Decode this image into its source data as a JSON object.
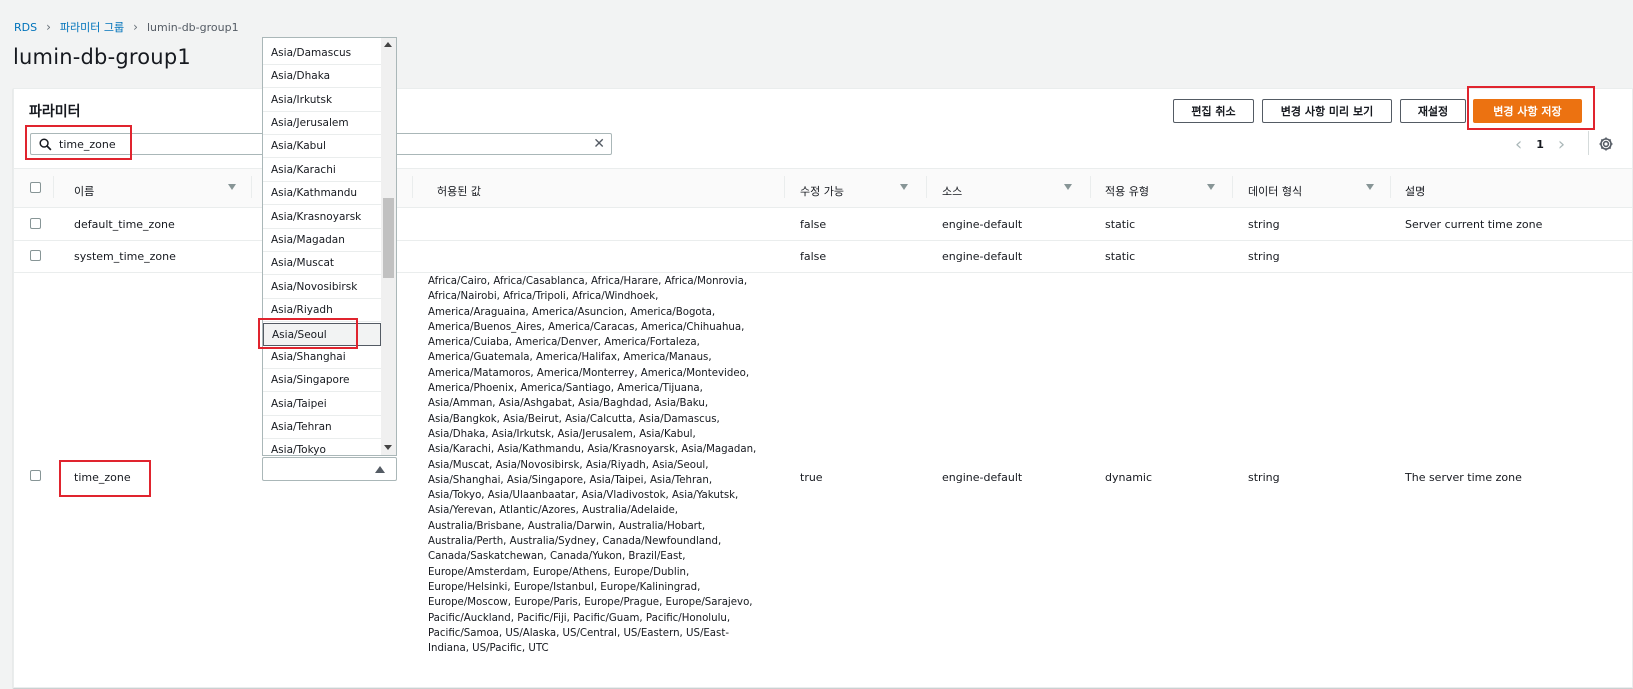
{
  "breadcrumb": {
    "root": "RDS",
    "parent": "파라미터 그룹",
    "current": "lumin-db-group1"
  },
  "page_title": "lumin-db-group1",
  "panel": {
    "title": "파라미터",
    "search_value": "time_zone",
    "buttons": {
      "cancel": "편집 취소",
      "preview": "변경 사항 미리 보기",
      "reset": "재설정",
      "save": "변경 사항 저장"
    },
    "pagination": {
      "page": "1"
    }
  },
  "table": {
    "headers": {
      "name": "이름",
      "allowed": "허용된 값",
      "modifiable": "수정 가능",
      "source": "소스",
      "apply_type": "적용 유형",
      "data_type": "데이터 형식",
      "description": "설명"
    },
    "rows": [
      {
        "name": "default_time_zone",
        "modifiable": "false",
        "source": "engine-default",
        "apply_type": "static",
        "data_type": "string",
        "description": "Server current time zone"
      },
      {
        "name": "system_time_zone",
        "modifiable": "false",
        "source": "engine-default",
        "apply_type": "static",
        "data_type": "string",
        "description": ""
      },
      {
        "name": "time_zone",
        "modifiable": "true",
        "source": "engine-default",
        "apply_type": "dynamic",
        "data_type": "string",
        "description": "The server time zone",
        "allowed": "Africa/Cairo, Africa/Casablanca, Africa/Harare, Africa/Monrovia,\nAfrica/Nairobi, Africa/Tripoli, Africa/Windhoek,\nAmerica/Araguaina, America/Asuncion, America/Bogota,\nAmerica/Buenos_Aires, America/Caracas, America/Chihuahua,\nAmerica/Cuiaba, America/Denver, America/Fortaleza,\nAmerica/Guatemala, America/Halifax, America/Manaus,\nAmerica/Matamoros, America/Monterrey, America/Montevideo,\nAmerica/Phoenix, America/Santiago, America/Tijuana,\nAsia/Amman, Asia/Ashgabat, Asia/Baghdad, Asia/Baku,\nAsia/Bangkok, Asia/Beirut, Asia/Calcutta, Asia/Damascus,\nAsia/Dhaka, Asia/Irkutsk, Asia/Jerusalem, Asia/Kabul,\nAsia/Karachi, Asia/Kathmandu, Asia/Krasnoyarsk, Asia/Magadan,\nAsia/Muscat, Asia/Novosibirsk, Asia/Riyadh, Asia/Seoul,\nAsia/Shanghai, Asia/Singapore, Asia/Taipei, Asia/Tehran,\nAsia/Tokyo, Asia/Ulaanbaatar, Asia/Vladivostok, Asia/Yakutsk,\nAsia/Yerevan, Atlantic/Azores, Australia/Adelaide,\nAustralia/Brisbane, Australia/Darwin, Australia/Hobart,\nAustralia/Perth, Australia/Sydney, Canada/Newfoundland,\nCanada/Saskatchewan, Canada/Yukon, Brazil/East,\nEurope/Amsterdam, Europe/Athens, Europe/Dublin,\nEurope/Helsinki, Europe/Istanbul, Europe/Kaliningrad,\nEurope/Moscow, Europe/Paris, Europe/Prague, Europe/Sarajevo,\nPacific/Auckland, Pacific/Fiji, Pacific/Guam, Pacific/Honolulu,\nPacific/Samoa, US/Alaska, US/Central, US/Eastern, US/East-\nIndiana, US/Pacific, UTC"
      }
    ]
  },
  "dropdown": {
    "options": [
      "Asia/Damascus",
      "Asia/Dhaka",
      "Asia/Irkutsk",
      "Asia/Jerusalem",
      "Asia/Kabul",
      "Asia/Karachi",
      "Asia/Kathmandu",
      "Asia/Krasnoyarsk",
      "Asia/Magadan",
      "Asia/Muscat",
      "Asia/Novosibirsk",
      "Asia/Riyadh",
      "Asia/Seoul",
      "Asia/Shanghai",
      "Asia/Singapore",
      "Asia/Taipei",
      "Asia/Tehran",
      "Asia/Tokyo"
    ],
    "highlighted": "Asia/Seoul"
  },
  "colors": {
    "accent": "#ec7211",
    "link": "#0073bb",
    "highlight_box": "#e0242e"
  },
  "icons": [
    "search-icon",
    "clear-icon",
    "chevron-right-icon",
    "chevron-left-icon",
    "settings-gear-icon",
    "sort-icon",
    "caret-up-icon"
  ]
}
